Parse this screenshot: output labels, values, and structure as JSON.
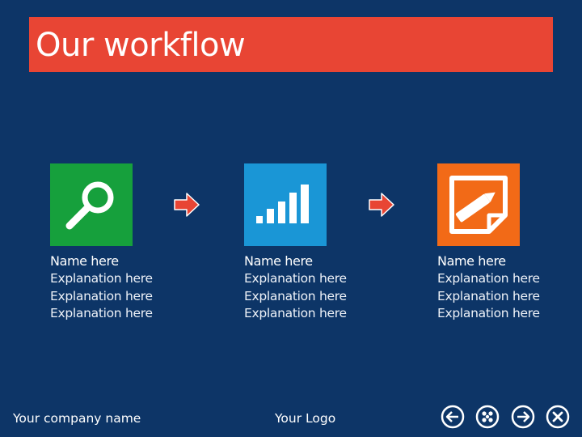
{
  "slide": {
    "title": "Our workflow"
  },
  "steps": [
    {
      "name": "Name here",
      "lines": [
        "Explanation here",
        "Explanation here",
        "Explanation here"
      ],
      "icon": "magnifier-icon",
      "color": "#16a03c"
    },
    {
      "name": "Name here",
      "lines": [
        "Explanation here",
        "Explanation here",
        "Explanation here"
      ],
      "icon": "signal-bars-icon",
      "color": "#1a96d6"
    },
    {
      "name": "Name here",
      "lines": [
        "Explanation here",
        "Explanation here",
        "Explanation here"
      ],
      "icon": "note-pencil-icon",
      "color": "#f26a17"
    }
  ],
  "footer": {
    "company": "Your company name",
    "logo": "Your Logo"
  },
  "nav": [
    "back-arrow-icon",
    "grid-menu-icon",
    "forward-arrow-icon",
    "close-icon"
  ],
  "colors": {
    "background": "#0d3567",
    "title_bar": "#e84534",
    "arrow": "#e84534"
  }
}
